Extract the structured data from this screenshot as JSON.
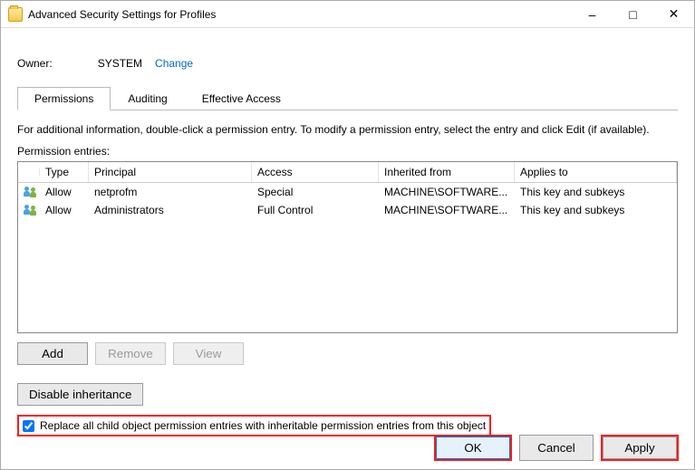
{
  "window": {
    "title": "Advanced Security Settings for Profiles"
  },
  "owner": {
    "label": "Owner:",
    "value": "SYSTEM",
    "change": "Change"
  },
  "tabs": {
    "permissions": "Permissions",
    "auditing": "Auditing",
    "effective": "Effective Access"
  },
  "instruction": "For additional information, double-click a permission entry. To modify a permission entry, select the entry and click Edit (if available).",
  "entries_label": "Permission entries:",
  "columns": {
    "type": "Type",
    "principal": "Principal",
    "access": "Access",
    "inherited": "Inherited from",
    "applies": "Applies to"
  },
  "rows": [
    {
      "type": "Allow",
      "principal": "netprofm",
      "access": "Special",
      "inherited": "MACHINE\\SOFTWARE...",
      "applies": "This key and subkeys"
    },
    {
      "type": "Allow",
      "principal": "Administrators",
      "access": "Full Control",
      "inherited": "MACHINE\\SOFTWARE...",
      "applies": "This key and subkeys"
    }
  ],
  "buttons": {
    "add": "Add",
    "remove": "Remove",
    "view": "View",
    "disable_inh": "Disable inheritance",
    "ok": "OK",
    "cancel": "Cancel",
    "apply": "Apply"
  },
  "checkbox": {
    "label": "Replace all child object permission entries with inheritable permission entries from this object",
    "checked": true
  }
}
